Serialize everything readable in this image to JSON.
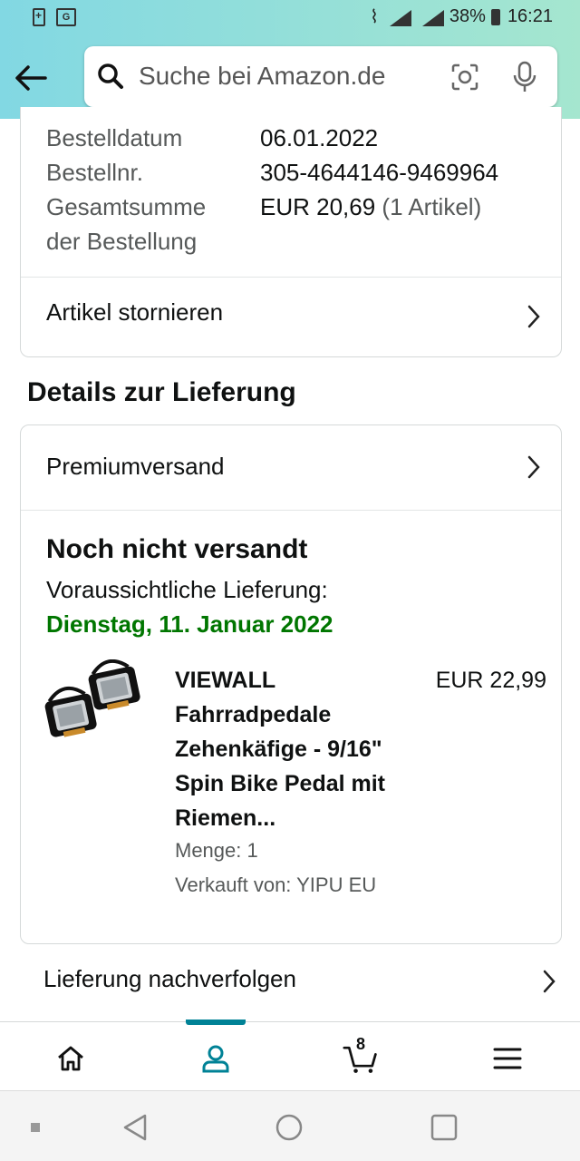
{
  "status_bar": {
    "battery_percent": "38%",
    "time": "16:21"
  },
  "search": {
    "placeholder": "Suche bei Amazon.de"
  },
  "order_info": {
    "date_label": "Bestelldatum",
    "date_value": "06.01.2022",
    "number_label": "Bestellnr.",
    "number_value": "305-4644146-9469964",
    "total_label_line1": "Gesamtsumme",
    "total_label_line2": "der Bestellung",
    "total_value": "EUR 20,69",
    "total_items": "(1 Artikel)",
    "cancel_link": "Artikel stornieren"
  },
  "delivery": {
    "section_title": "Details zur Lieferung",
    "shipping_method": "Premiumversand",
    "status": "Noch nicht versandt",
    "eta_label": "Voraussichtliche Lieferung:",
    "eta_date": "Dienstag, 11. Januar 2022",
    "product": {
      "title": "VIEWALL Fahrradpedale Zehenkäfige - 9/16\" Spin Bike Pedal mit Riemen...",
      "price": "EUR 22,99",
      "quantity": "Menge: 1",
      "seller": "Verkauft von: YIPU EU"
    },
    "track_link": "Lieferung nachverfolgen"
  },
  "bottom_nav": {
    "cart_count": "8",
    "accent": "#008296"
  },
  "colors": {
    "eta_green": "#007600",
    "header_gradient_start": "#82d8e3",
    "header_gradient_end": "#a5e6cf"
  }
}
